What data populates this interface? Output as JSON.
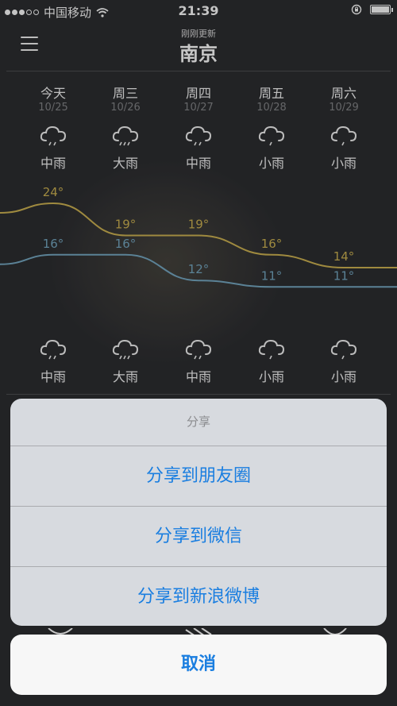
{
  "status_bar": {
    "carrier": "中国移动",
    "time": "21:39"
  },
  "header": {
    "updated": "刚刚更新",
    "city": "南京"
  },
  "forecast": {
    "days": [
      {
        "name": "今天",
        "date": "10/25",
        "condition": "中雨",
        "icon": "rain-cloud-icon",
        "high": "24°",
        "low": "16°"
      },
      {
        "name": "周三",
        "date": "10/26",
        "condition": "大雨",
        "icon": "heavy-rain-cloud-icon",
        "high": "19°",
        "low": "16°"
      },
      {
        "name": "周四",
        "date": "10/27",
        "condition": "中雨",
        "icon": "rain-cloud-icon",
        "high": "19°",
        "low": "12°"
      },
      {
        "name": "周五",
        "date": "10/28",
        "condition": "小雨",
        "icon": "light-rain-cloud-icon",
        "high": "16°",
        "low": "11°"
      },
      {
        "name": "周六",
        "date": "10/29",
        "condition": "小雨",
        "icon": "light-rain-cloud-icon",
        "high": "14°",
        "low": "11°"
      }
    ],
    "night": [
      {
        "condition": "中雨",
        "icon": "rain-cloud-icon"
      },
      {
        "condition": "大雨",
        "icon": "heavy-rain-cloud-icon"
      },
      {
        "condition": "中雨",
        "icon": "rain-cloud-icon"
      },
      {
        "condition": "小雨",
        "icon": "light-rain-cloud-icon"
      },
      {
        "condition": "小雨",
        "icon": "light-rain-cloud-icon"
      }
    ],
    "high_values": [
      24,
      19,
      19,
      16,
      14
    ],
    "low_values": [
      16,
      16,
      12,
      11,
      11
    ],
    "colors": {
      "high": "#c2a94e",
      "low": "#6f9fb8"
    }
  },
  "share_sheet": {
    "title": "分享",
    "options": [
      "分享到朋友圈",
      "分享到微信",
      "分享到新浪微博"
    ],
    "cancel": "取消"
  },
  "colors": {
    "accent": "#1a7ee0",
    "background": "#2a2b2e"
  }
}
